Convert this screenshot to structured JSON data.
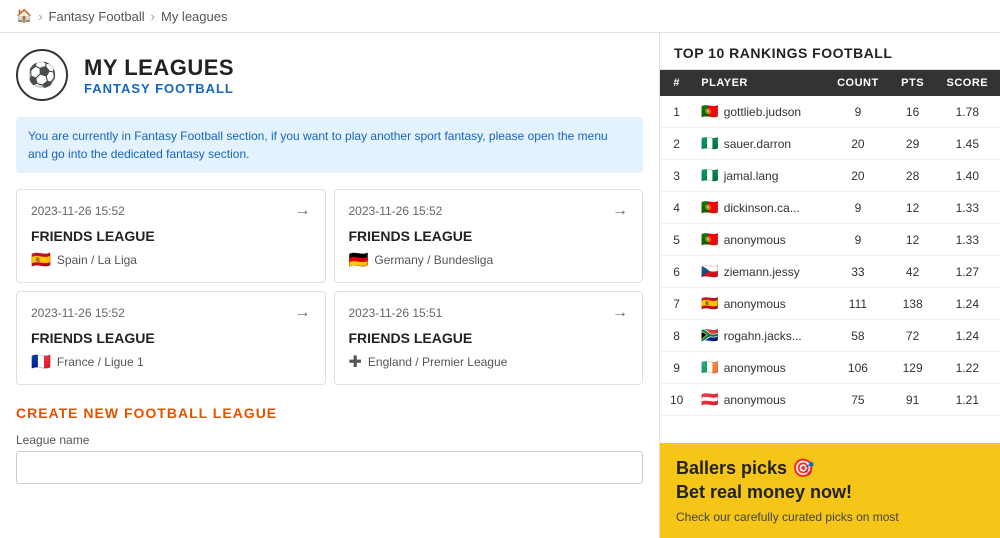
{
  "breadcrumb": {
    "home_icon": "🏠",
    "items": [
      "Fantasy Football",
      "My leagues"
    ]
  },
  "header": {
    "icon": "⚽",
    "title": "MY LEAGUES",
    "subtitle": "FANTASY FOOTBALL"
  },
  "info_banner": "You are currently in Fantasy Football section, if you want to play another sport fantasy, please open the menu and go into the dedicated fantasy section.",
  "leagues": [
    {
      "date": "2023-11-26 15:52",
      "name": "FRIENDS LEAGUE",
      "flag": "🇪🇸",
      "competition": "Spain / La Liga"
    },
    {
      "date": "2023-11-26 15:52",
      "name": "FRIENDS LEAGUE",
      "flag": "🇩🇪",
      "competition": "Germany / Bundesliga"
    },
    {
      "date": "2023-11-26 15:52",
      "name": "FRIENDS LEAGUE",
      "flag": "🇫🇷",
      "competition": "France / Ligue 1"
    },
    {
      "date": "2023-11-26 15:51",
      "name": "FRIENDS LEAGUE",
      "flag": "🏴󠁧󠁢󠁥󠁮󠁧󠁿",
      "competition": "England / Premier League",
      "flag_symbol": "✚"
    }
  ],
  "create_section": {
    "title": "CREATE NEW FOOTBALL LEAGUE",
    "league_name_label": "League name",
    "league_name_placeholder": ""
  },
  "rankings": {
    "title": "TOP 10 RANKINGS FOOTBALL",
    "columns": [
      "#",
      "PLAYER",
      "COUNT",
      "PTS",
      "SCORE"
    ],
    "rows": [
      {
        "rank": 1,
        "flag": "🇵🇹",
        "player": "gottlieb.judson",
        "count": 9,
        "pts": 16,
        "score": "1.78"
      },
      {
        "rank": 2,
        "flag": "🇳🇬",
        "player": "sauer.darron",
        "count": 20,
        "pts": 29,
        "score": "1.45"
      },
      {
        "rank": 3,
        "flag": "🇳🇬",
        "player": "jamal.lang",
        "count": 20,
        "pts": 28,
        "score": "1.40"
      },
      {
        "rank": 4,
        "flag": "🇵🇹",
        "player": "dickinson.ca...",
        "count": 9,
        "pts": 12,
        "score": "1.33"
      },
      {
        "rank": 5,
        "flag": "🇵🇹",
        "player": "anonymous",
        "count": 9,
        "pts": 12,
        "score": "1.33"
      },
      {
        "rank": 6,
        "flag": "🇨🇿",
        "player": "ziemann.jessy",
        "count": 33,
        "pts": 42,
        "score": "1.27"
      },
      {
        "rank": 7,
        "flag": "🇪🇸",
        "player": "anonymous",
        "count": 111,
        "pts": 138,
        "score": "1.24"
      },
      {
        "rank": 8,
        "flag": "🇿🇦",
        "player": "rogahn.jacks...",
        "count": 58,
        "pts": 72,
        "score": "1.24"
      },
      {
        "rank": 9,
        "flag": "🇮🇪",
        "player": "anonymous",
        "count": 106,
        "pts": 129,
        "score": "1.22"
      },
      {
        "rank": 10,
        "flag": "🇦🇹",
        "player": "anonymous",
        "count": 75,
        "pts": 91,
        "score": "1.21"
      }
    ]
  },
  "promo": {
    "title": "Ballers picks 🎯",
    "title2": "Bet real money now!",
    "subtitle": "Check our carefully curated picks on most"
  }
}
